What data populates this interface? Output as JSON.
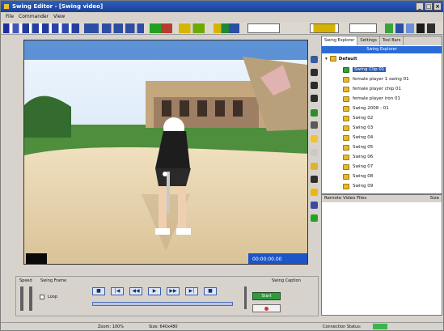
{
  "window": {
    "title": "Swing Editor - [Swing video]"
  },
  "menu": {
    "items": [
      "File",
      "Commander",
      "View"
    ]
  },
  "panel": {
    "tabs": [
      "Swing Explorer",
      "Settings",
      "Tool Bars"
    ],
    "header": "Swing Explorer",
    "root_label": "Default",
    "items": [
      "Swing Clip 01",
      "female player 1 swing 01",
      "female player chip 01",
      "female player iron 01",
      "Swing 2008 - 01",
      "Swing 02",
      "Swing 03",
      "Swing 04",
      "Swing 05",
      "Swing 06",
      "Swing 07",
      "Swing 08",
      "Swing 09"
    ]
  },
  "remote": {
    "title": "Remote Video Files",
    "size_label": "Size"
  },
  "controls": {
    "speed_label": "Speed",
    "swing_frame_label": "Swing Frame",
    "swing_caption_label": "Swing Caption",
    "loop_label": "Loop",
    "play_buttons": [
      "■",
      "|◀",
      "◀◀",
      "▶",
      "▶▶",
      "▶|",
      "■"
    ],
    "caption_button": "Start"
  },
  "status": {
    "zoom": "Zoom: 100%",
    "size": "Size: 640x480",
    "connection": "Connection Status:"
  }
}
